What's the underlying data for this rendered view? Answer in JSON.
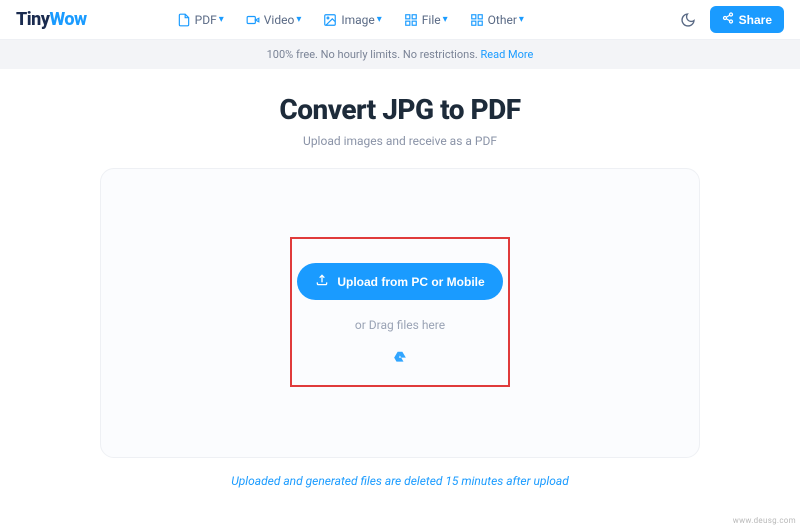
{
  "logo": {
    "part1": "Tiny",
    "part2": "Wow"
  },
  "nav": {
    "items": [
      {
        "label": "PDF"
      },
      {
        "label": "Video"
      },
      {
        "label": "Image"
      },
      {
        "label": "File"
      },
      {
        "label": "Other"
      }
    ]
  },
  "share_label": "Share",
  "banner": {
    "text": "100% free. No hourly limits. No restrictions. ",
    "link": "Read More"
  },
  "page": {
    "title": "Convert JPG to PDF",
    "subtitle": "Upload images and receive as a PDF"
  },
  "upload": {
    "button": "Upload from PC or Mobile",
    "drag": "or Drag files here"
  },
  "footer_note": "Uploaded and generated files are deleted 15 minutes after upload",
  "watermark": "www.deusg.com"
}
